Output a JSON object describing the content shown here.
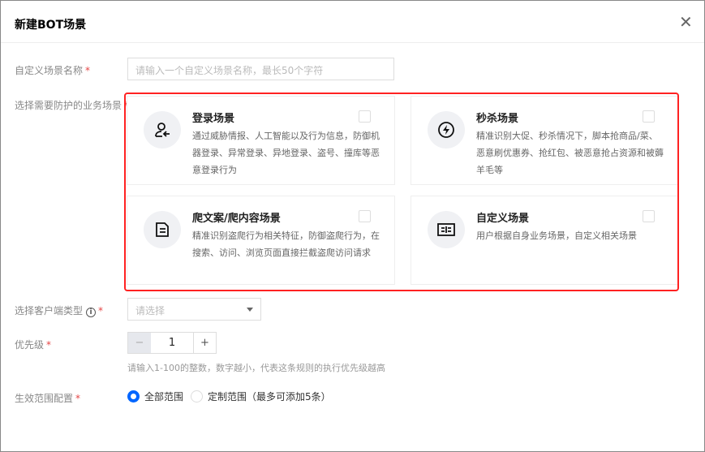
{
  "dialog": {
    "title": "新建BOT场景",
    "close_icon": "close-icon"
  },
  "form": {
    "name_label": "自定义场景名称",
    "name_placeholder": "请输入一个自定义场景名称，最长50个字符",
    "scene_label": "选择需要防护的业务场景",
    "scenes": [
      {
        "title": "登录场景",
        "desc": "通过威胁情报、人工智能以及行为信息，防御机器登录、异常登录、异地登录、盗号、撞库等恶意登录行为",
        "icon": "user-login-icon",
        "checked": false
      },
      {
        "title": "秒杀场景",
        "desc": "精准识别大促、秒杀情况下，脚本抢商品/菜、恶意刷优惠券、抢红包、被恶意抢占资源和被薅羊毛等",
        "icon": "lightning-icon",
        "checked": false
      },
      {
        "title": "爬文案/爬内容场景",
        "desc": "精准识别盗爬行为相关特征，防御盗爬行为，在搜索、访问、浏览页面直接拦截盗爬访问请求",
        "icon": "document-icon",
        "checked": false
      },
      {
        "title": "自定义场景",
        "desc": "用户根据自身业务场景，自定义相关场景",
        "icon": "custom-settings-icon",
        "checked": false
      }
    ],
    "client_label": "选择客户端类型",
    "client_placeholder": "请选择",
    "info_glyph": "i",
    "priority_label": "优先级",
    "priority_value": "1",
    "minus": "−",
    "plus": "+",
    "priority_hint": "请输入1-100的整数，数字越小，代表这条规则的执行优先级越高",
    "scope_label": "生效范围配置",
    "scope_options": [
      "全部范围",
      "定制范围（最多可添加5条）"
    ],
    "scope_selected": "全部范围",
    "required_mark": "*"
  },
  "colors": {
    "accent": "#0066ff",
    "highlight": "#ff2222",
    "required": "#e54545"
  }
}
